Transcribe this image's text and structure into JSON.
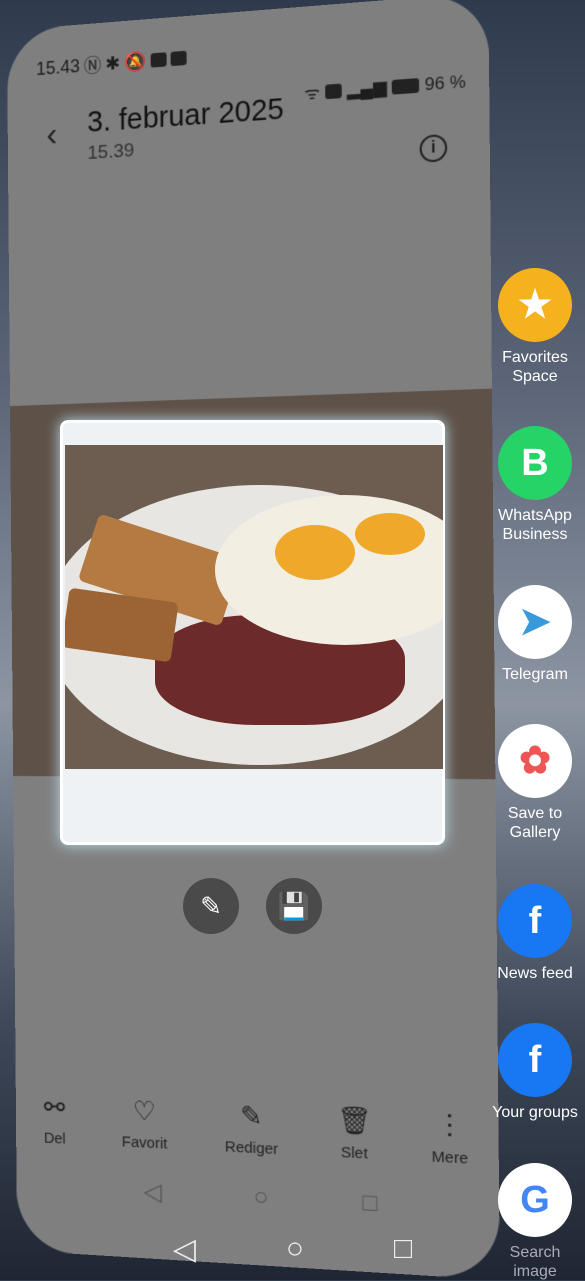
{
  "status": {
    "time": "15.43",
    "battery": "96 %"
  },
  "header": {
    "title": "3. februar 2025",
    "subtitle": "15.39"
  },
  "actions": [
    {
      "label": "Del",
      "icon": "share-icon"
    },
    {
      "label": "Favorit",
      "icon": "heart-icon"
    },
    {
      "label": "Rediger",
      "icon": "edit-icon"
    },
    {
      "label": "Slet",
      "icon": "trash-icon"
    },
    {
      "label": "Mere",
      "icon": "more-icon"
    }
  ],
  "share_targets": [
    {
      "label": "Favorites Space",
      "color": "#f6b21c"
    },
    {
      "label": "WhatsApp Business",
      "color": "#25d366"
    },
    {
      "label": "Telegram",
      "color": "#ffffff"
    },
    {
      "label": "Save to Gallery",
      "color": "#ffffff"
    },
    {
      "label": "News feed",
      "color": "#1877f2"
    },
    {
      "label": "Your groups",
      "color": "#1877f2"
    },
    {
      "label": "Search image",
      "color": "#ffffff"
    }
  ]
}
